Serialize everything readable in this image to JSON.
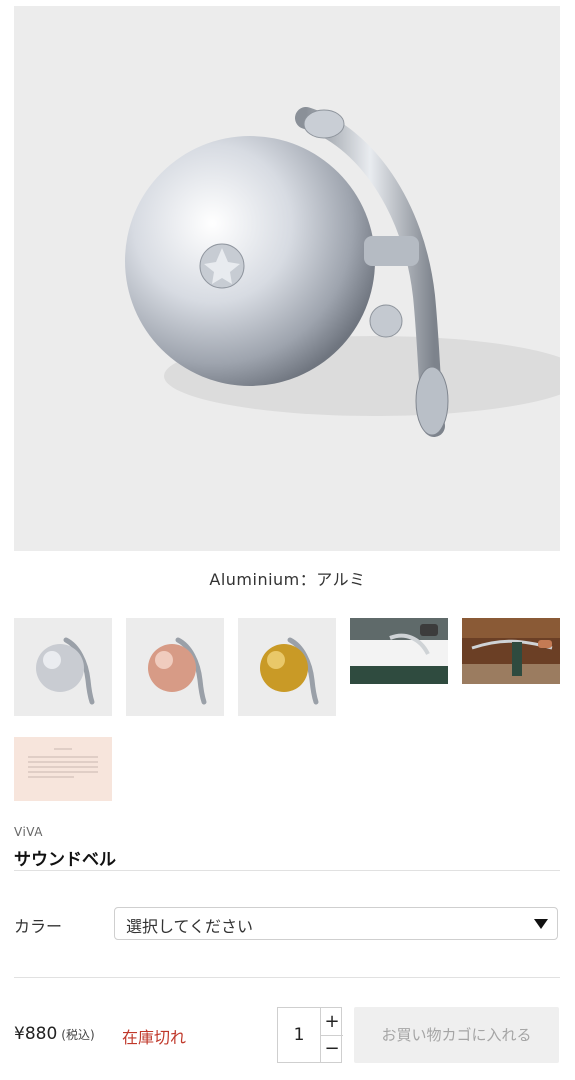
{
  "gallery": {
    "caption": "Aluminium：アルミ",
    "main_image": "bell-silver-image",
    "thumbnails": [
      {
        "name": "thumb-silver-bell",
        "kind": "bell",
        "color": "#c9ccd2"
      },
      {
        "name": "thumb-copper-bell",
        "kind": "bell",
        "color": "#d79b86"
      },
      {
        "name": "thumb-gold-bell",
        "kind": "bell",
        "color": "#c99a26"
      },
      {
        "name": "thumb-bike-handlebar-photo",
        "kind": "photo"
      },
      {
        "name": "thumb-bike-street-photo",
        "kind": "photo"
      },
      {
        "name": "thumb-product-card",
        "kind": "card",
        "color": "#f7e5dc"
      }
    ]
  },
  "product": {
    "brand": "ViVA",
    "title": "サウンドベル"
  },
  "options": {
    "color_label": "カラー",
    "color_select_value": "選択してください",
    "caret_icon": "chevron-down-icon"
  },
  "purchase": {
    "price": "¥880",
    "tax_note": "(税込)",
    "stock_status": "在庫切れ",
    "quantity": "1",
    "plus_symbol": "+",
    "minus_symbol": "−",
    "add_to_cart_label": "お買い物カゴに入れる"
  },
  "colors": {
    "stock_red": "#c0392b",
    "button_bg": "#efefef",
    "button_text": "#a5a5a5"
  }
}
